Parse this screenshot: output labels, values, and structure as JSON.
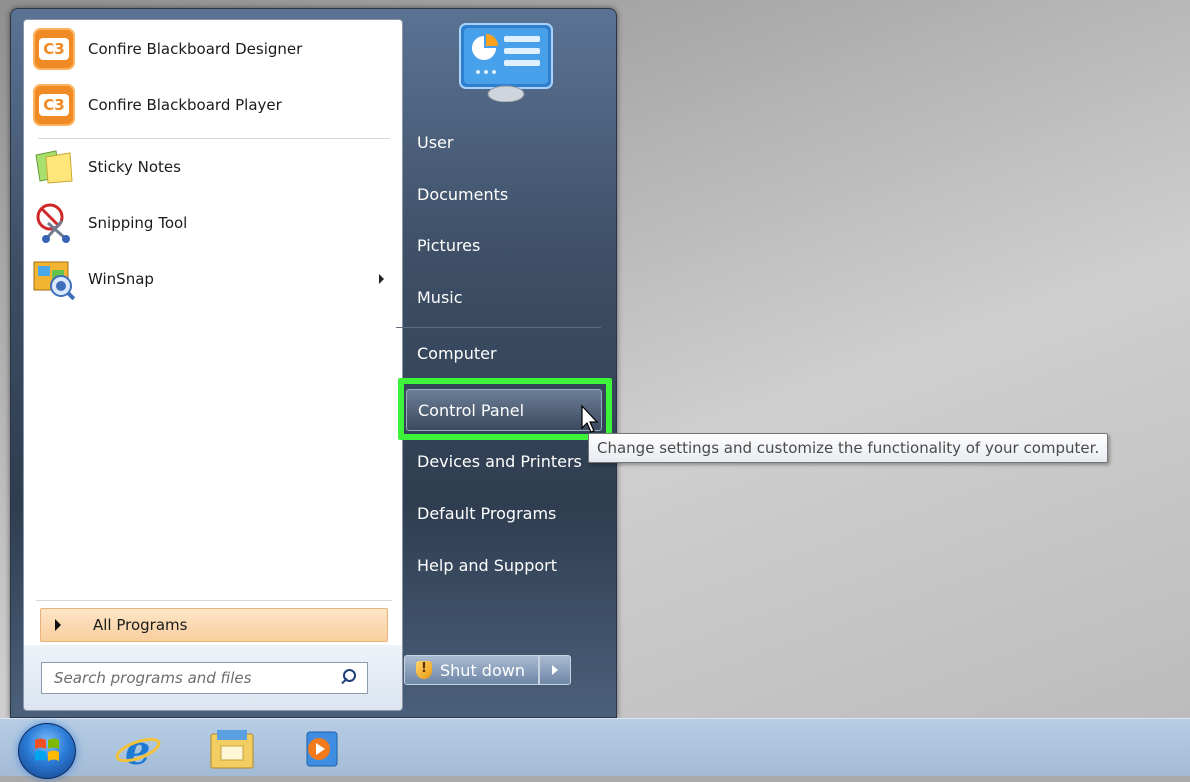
{
  "start_menu": {
    "programs": [
      {
        "label": "Confire Blackboard Designer",
        "icon": "confire-icon"
      },
      {
        "label": "Confire Blackboard Player",
        "icon": "confire-icon"
      },
      {
        "label": "Sticky Notes",
        "icon": "sticky-notes-icon"
      },
      {
        "label": "Snipping Tool",
        "icon": "snipping-tool-icon"
      },
      {
        "label": "WinSnap",
        "icon": "winsnap-icon",
        "has_submenu": true
      }
    ],
    "all_programs_label": "All Programs",
    "search_placeholder": "Search programs and files",
    "right_items": [
      {
        "label": "User"
      },
      {
        "label": "Documents"
      },
      {
        "label": "Pictures"
      },
      {
        "label": "Music"
      },
      {
        "label": "Computer"
      },
      {
        "label": "Control Panel",
        "hovered": true
      },
      {
        "label": "Devices and Printers"
      },
      {
        "label": "Default Programs"
      },
      {
        "label": "Help and Support"
      }
    ],
    "shutdown_label": "Shut down",
    "tooltip": "Change settings and customize the functionality of your computer."
  },
  "highlight_color": "#3df43a",
  "taskbar": {
    "items": [
      "start-orb",
      "internet-explorer-icon",
      "file-explorer-icon",
      "media-player-icon"
    ]
  }
}
